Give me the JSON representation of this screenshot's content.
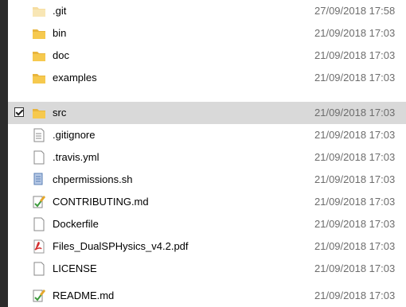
{
  "files": [
    {
      "name": ".git",
      "date": "27/09/2018 17:58",
      "icon": "folder-faded-icon",
      "selected": false
    },
    {
      "name": "bin",
      "date": "21/09/2018 17:03",
      "icon": "folder-icon",
      "selected": false
    },
    {
      "name": "doc",
      "date": "21/09/2018 17:03",
      "icon": "folder-icon",
      "selected": false
    },
    {
      "name": "examples",
      "date": "21/09/2018 17:03",
      "icon": "folder-icon",
      "selected": false
    },
    {
      "name": "src",
      "date": "21/09/2018 17:03",
      "icon": "folder-icon",
      "selected": true
    },
    {
      "name": ".gitignore",
      "date": "21/09/2018 17:03",
      "icon": "text-file-icon",
      "selected": false
    },
    {
      "name": ".travis.yml",
      "date": "21/09/2018 17:03",
      "icon": "blank-file-icon",
      "selected": false
    },
    {
      "name": "chpermissions.sh",
      "date": "21/09/2018 17:03",
      "icon": "script-file-icon",
      "selected": false
    },
    {
      "name": "CONTRIBUTING.md",
      "date": "21/09/2018 17:03",
      "icon": "markdown-edit-icon",
      "selected": false
    },
    {
      "name": "Dockerfile",
      "date": "21/09/2018 17:03",
      "icon": "blank-file-icon",
      "selected": false
    },
    {
      "name": "Files_DualSPHysics_v4.2.pdf",
      "date": "21/09/2018 17:03",
      "icon": "pdf-file-icon",
      "selected": false
    },
    {
      "name": "LICENSE",
      "date": "21/09/2018 17:03",
      "icon": "blank-file-icon",
      "selected": false
    },
    {
      "name": "README.md",
      "date": "21/09/2018 17:03",
      "icon": "markdown-edit-icon",
      "selected": false
    }
  ],
  "colors": {
    "folder": "#f6c94e",
    "selected_row": "#d9d9d9",
    "date_text": "#6d6d6d",
    "pdf": "#d32f2f"
  }
}
